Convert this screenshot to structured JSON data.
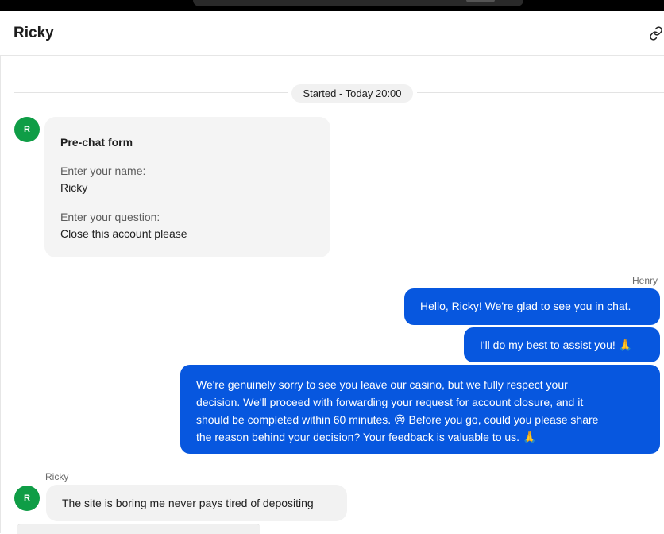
{
  "header": {
    "title": "Ricky",
    "link_icon": "link-icon"
  },
  "divider": {
    "label": "Started - Today 20:00"
  },
  "prechat": {
    "avatar_initial": "R",
    "title": "Pre-chat form",
    "name_label": "Enter your name:",
    "name_value": "Ricky",
    "question_label": "Enter your question:",
    "question_value": "Close this account please"
  },
  "agent": {
    "name": "Henry",
    "messages": [
      "Hello, Ricky! We're glad to see you in chat.",
      "I'll do my best to assist you! 🙏"
    ],
    "long_message_lines": [
      "We're genuinely sorry to see you leave our casino, but we fully respect your",
      "decision. We'll proceed with forwarding your request for account closure, and it",
      "should be completed within 60 minutes. 😢 Before you go, could you please share",
      "the reason behind your decision? Your feedback is valuable to us. 🙏"
    ]
  },
  "user": {
    "name": "Ricky",
    "avatar_initial": "R",
    "message": "The site is boring me never pays tired of depositing"
  },
  "colors": {
    "agent_bubble": "#0757df",
    "avatar": "#0f9d46",
    "incoming_bubble": "#f2f2f2"
  }
}
